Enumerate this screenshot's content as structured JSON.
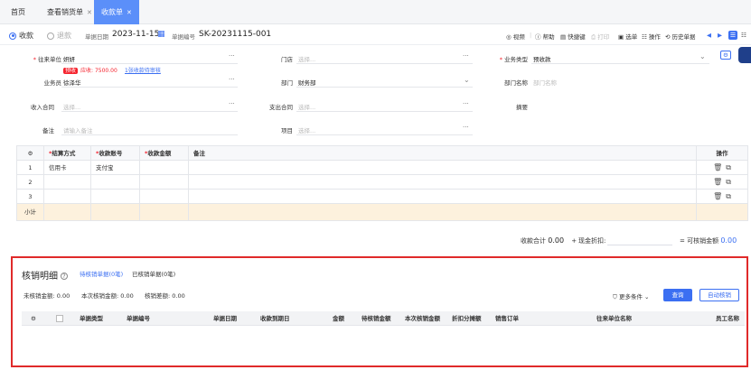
{
  "tabs": [
    {
      "label": "首页",
      "closable": false,
      "active": false
    },
    {
      "label": "查看销货单",
      "closable": true,
      "active": false
    },
    {
      "label": "收款单",
      "closable": true,
      "active": true
    }
  ],
  "toolbar": {
    "mode_receive": "收款",
    "mode_refund": "退款",
    "date_label": "单据日期",
    "date_value": "2023-11-15",
    "no_label": "单据编号",
    "no_value": "SK-20231115-001",
    "buttons": [
      "视频",
      "帮助",
      "快捷键",
      "打印",
      "选单",
      "操作",
      "历史单据"
    ]
  },
  "form": {
    "partner_label": "往来单位",
    "partner_value": "妍妍",
    "credit_tag": "预收",
    "credit_text": "应收: 7500.00",
    "pending_link": "1张收款待审核",
    "salesman_label": "业务员",
    "salesman_value": "徐泽华",
    "income_contract_label": "收入合同",
    "income_contract_ph": "选择...",
    "remark_label": "备注",
    "remark_ph": "请输入备注",
    "store_label": "门店",
    "store_ph": "选择...",
    "dept_label": "部门",
    "dept_value": "财务部",
    "expense_contract_label": "支出合同",
    "expense_contract_ph": "选择...",
    "project_label": "项目",
    "project_ph": "选择...",
    "biztype_label": "业务类型",
    "biztype_value": "预收款",
    "deptname_label": "部门名称",
    "deptname_ph": "部门名称",
    "summary_label": "摘要"
  },
  "grid": {
    "headers": {
      "settle": "结算方式",
      "account": "收款账号",
      "amount": "收款金额",
      "remark": "备注",
      "ops": "操作"
    },
    "rows": [
      {
        "no": "1",
        "settle": "信用卡",
        "account": "支付宝",
        "amount": "",
        "remark": ""
      },
      {
        "no": "2",
        "settle": "",
        "account": "",
        "amount": "",
        "remark": ""
      },
      {
        "no": "3",
        "settle": "",
        "account": "",
        "amount": "",
        "remark": ""
      }
    ],
    "subtotal_label": "小计"
  },
  "totals": {
    "sum_label": "收款合计",
    "sum_value": "0.00",
    "discount_label": "现金折扣:",
    "writeoff_label": "可核销金额",
    "writeoff_value": "0.00"
  },
  "detail": {
    "title": "核销明细",
    "tab_pending": "待核销单据(0笔)",
    "tab_done": "已核销单据(0笔)",
    "unwritten_label": "未核销金额:",
    "unwritten_value": "0.00",
    "current_label": "本次核销金额:",
    "current_value": "0.00",
    "diff_label": "核销差额:",
    "diff_value": "0.00",
    "more_filter": "更多条件",
    "query_btn": "查询",
    "auto_btn": "自动核销",
    "columns": [
      "单据类型",
      "单据编号",
      "单据日期",
      "收款到期日",
      "金额",
      "待核销金额",
      "本次核销金额",
      "折扣分摊额",
      "销售订单",
      "往来单位名称",
      "员工名称"
    ]
  },
  "colors": {
    "primary": "#3b6ff2",
    "tab_active": "#5b8ff9",
    "danger": "#f5222d",
    "subtotal_bg": "#fdf1dd"
  }
}
